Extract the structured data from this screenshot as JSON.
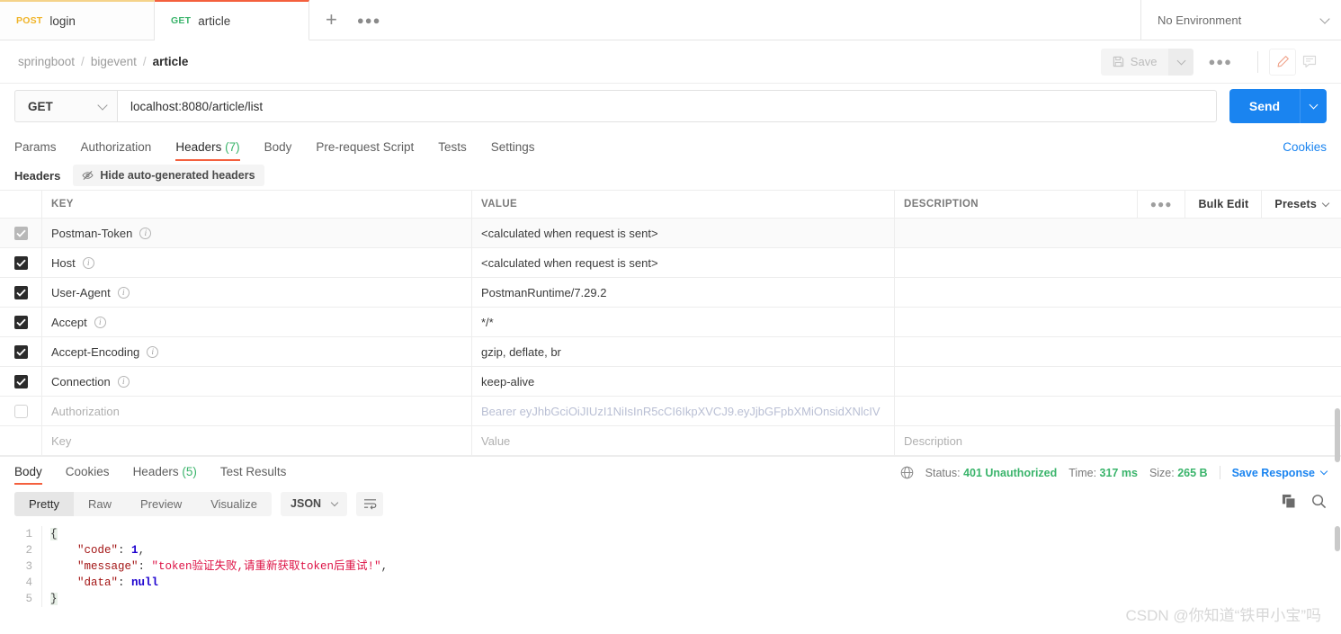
{
  "tabbar": {
    "tabs": [
      {
        "method": "POST",
        "name": "login",
        "active": false
      },
      {
        "method": "GET",
        "name": "article",
        "active": true
      }
    ],
    "new_tab_icon": "plus-icon",
    "more_icon": "ellipsis-icon",
    "environment": "No Environment"
  },
  "breadcrumb": {
    "items": [
      "springboot",
      "bigevent",
      "article"
    ],
    "sep": "/",
    "save_label": "Save",
    "more_label": "●●●"
  },
  "request": {
    "method": "GET",
    "url": "localhost:8080/article/list",
    "send_label": "Send"
  },
  "request_tabs": [
    {
      "label": "Params",
      "count": "",
      "active": false
    },
    {
      "label": "Authorization",
      "count": "",
      "active": false
    },
    {
      "label": "Headers",
      "count": "(7)",
      "active": true
    },
    {
      "label": "Body",
      "count": "",
      "active": false
    },
    {
      "label": "Pre-request Script",
      "count": "",
      "active": false
    },
    {
      "label": "Tests",
      "count": "",
      "active": false
    },
    {
      "label": "Settings",
      "count": "",
      "active": false
    }
  ],
  "cookies_link": "Cookies",
  "headers_panel": {
    "title": "Headers",
    "hide_autogen_label": "Hide auto-generated headers",
    "columns": {
      "key": "KEY",
      "value": "VALUE",
      "description": "DESCRIPTION"
    },
    "actions": {
      "dots": "●●●",
      "bulk_edit": "Bulk Edit",
      "presets": "Presets"
    },
    "rows": [
      {
        "checked": "dim",
        "key": "Postman-Token",
        "info": true,
        "value": "<calculated when request is sent>",
        "description": ""
      },
      {
        "checked": "on",
        "key": "Host",
        "info": true,
        "value": "<calculated when request is sent>",
        "description": ""
      },
      {
        "checked": "on",
        "key": "User-Agent",
        "info": true,
        "value": "PostmanRuntime/7.29.2",
        "description": ""
      },
      {
        "checked": "on",
        "key": "Accept",
        "info": true,
        "value": "*/*",
        "description": ""
      },
      {
        "checked": "on",
        "key": "Accept-Encoding",
        "info": true,
        "value": "gzip, deflate, br",
        "description": ""
      },
      {
        "checked": "on",
        "key": "Connection",
        "info": true,
        "value": "keep-alive",
        "description": ""
      },
      {
        "checked": "off",
        "key": "Authorization",
        "info": false,
        "value": "Bearer eyJhbGciOiJIUzI1NiIsInR5cCI6IkpXVCJ9.eyJjbGFpbXMiOnsidXNlcIV",
        "description": "",
        "muted_key": true,
        "token": true
      },
      {
        "checked": "none",
        "key": "Key",
        "info": false,
        "value": "Value",
        "description": "Description",
        "placeholder": true
      }
    ]
  },
  "response": {
    "tabs": [
      {
        "label": "Body",
        "count": "",
        "active": true
      },
      {
        "label": "Cookies",
        "count": "",
        "active": false
      },
      {
        "label": "Headers",
        "count": "(5)",
        "active": false
      },
      {
        "label": "Test Results",
        "count": "",
        "active": false
      }
    ],
    "status_label": "Status:",
    "status_value": "401 Unauthorized",
    "time_label": "Time:",
    "time_value": "317 ms",
    "size_label": "Size:",
    "size_value": "265 B",
    "save_response": "Save Response",
    "view_modes": [
      {
        "label": "Pretty",
        "active": true
      },
      {
        "label": "Raw",
        "active": false
      },
      {
        "label": "Preview",
        "active": false
      },
      {
        "label": "Visualize",
        "active": false
      }
    ],
    "format": "JSON",
    "body_lines": [
      {
        "no": "1",
        "tokens": [
          {
            "t": "brace",
            "v": "{"
          }
        ]
      },
      {
        "no": "2",
        "tokens": [
          {
            "t": "p",
            "v": "    "
          },
          {
            "t": "k",
            "v": "\"code\""
          },
          {
            "t": "p",
            "v": ": "
          },
          {
            "t": "n",
            "v": "1"
          },
          {
            "t": "p",
            "v": ","
          }
        ]
      },
      {
        "no": "3",
        "tokens": [
          {
            "t": "p",
            "v": "    "
          },
          {
            "t": "k",
            "v": "\"message\""
          },
          {
            "t": "p",
            "v": ": "
          },
          {
            "t": "s",
            "v": "\"token验证失败,请重新获取token后重试!\""
          },
          {
            "t": "p",
            "v": ","
          }
        ]
      },
      {
        "no": "4",
        "tokens": [
          {
            "t": "p",
            "v": "    "
          },
          {
            "t": "k",
            "v": "\"data\""
          },
          {
            "t": "p",
            "v": ": "
          },
          {
            "t": "n",
            "v": "null"
          }
        ]
      },
      {
        "no": "5",
        "tokens": [
          {
            "t": "brace",
            "v": "}"
          }
        ]
      }
    ]
  },
  "watermark": "CSDN @你知道“铁甲小宝”吗"
}
